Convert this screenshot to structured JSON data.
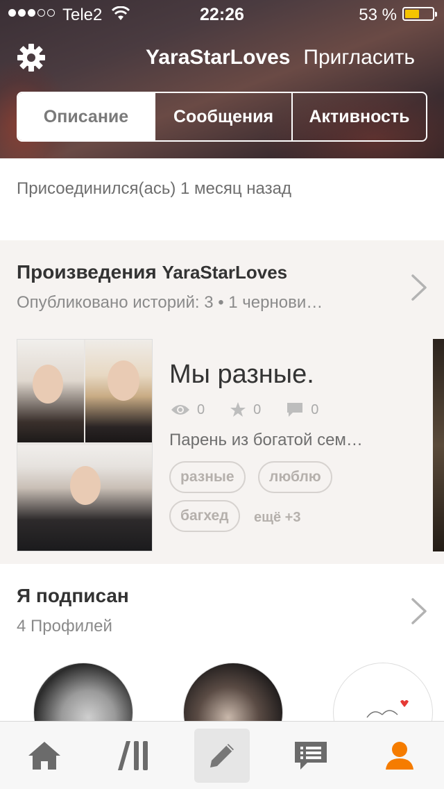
{
  "status_bar": {
    "carrier": "Tele2",
    "time": "22:26",
    "battery_percent": "53 %",
    "battery_level": 0.53,
    "signal_bars": 3,
    "signal_total": 5
  },
  "header": {
    "username": "YaraStarLoves",
    "invite_label": "Пригласить",
    "settings_icon": "gear-icon"
  },
  "tabs": [
    {
      "label": "Описание",
      "selected": true
    },
    {
      "label": "Сообщения",
      "selected": false
    },
    {
      "label": "Активность",
      "selected": false
    }
  ],
  "joined_text": "Присоединился(ась) 1 месяц назад",
  "works": {
    "title_prefix": "Произведения",
    "title_user": "YaraStarLoves",
    "subtitle": "Опубликовано историй: 3 • 1 чернови…",
    "story": {
      "title": "Мы разные.",
      "views": "0",
      "votes": "0",
      "comments": "0",
      "description": "Парень из богатой сем…",
      "tags": [
        "разные",
        "люблю",
        "багхед"
      ],
      "more_tags": "ещё +3"
    }
  },
  "following": {
    "title": "Я подписан",
    "subtitle": "4 Профилей"
  },
  "tab_bar": {
    "items": [
      {
        "icon": "home-icon"
      },
      {
        "icon": "library-icon"
      },
      {
        "icon": "write-pencil-icon"
      },
      {
        "icon": "messages-icon"
      },
      {
        "icon": "profile-icon"
      }
    ],
    "active_color": "#f57c00",
    "inactive_color": "#666666"
  }
}
